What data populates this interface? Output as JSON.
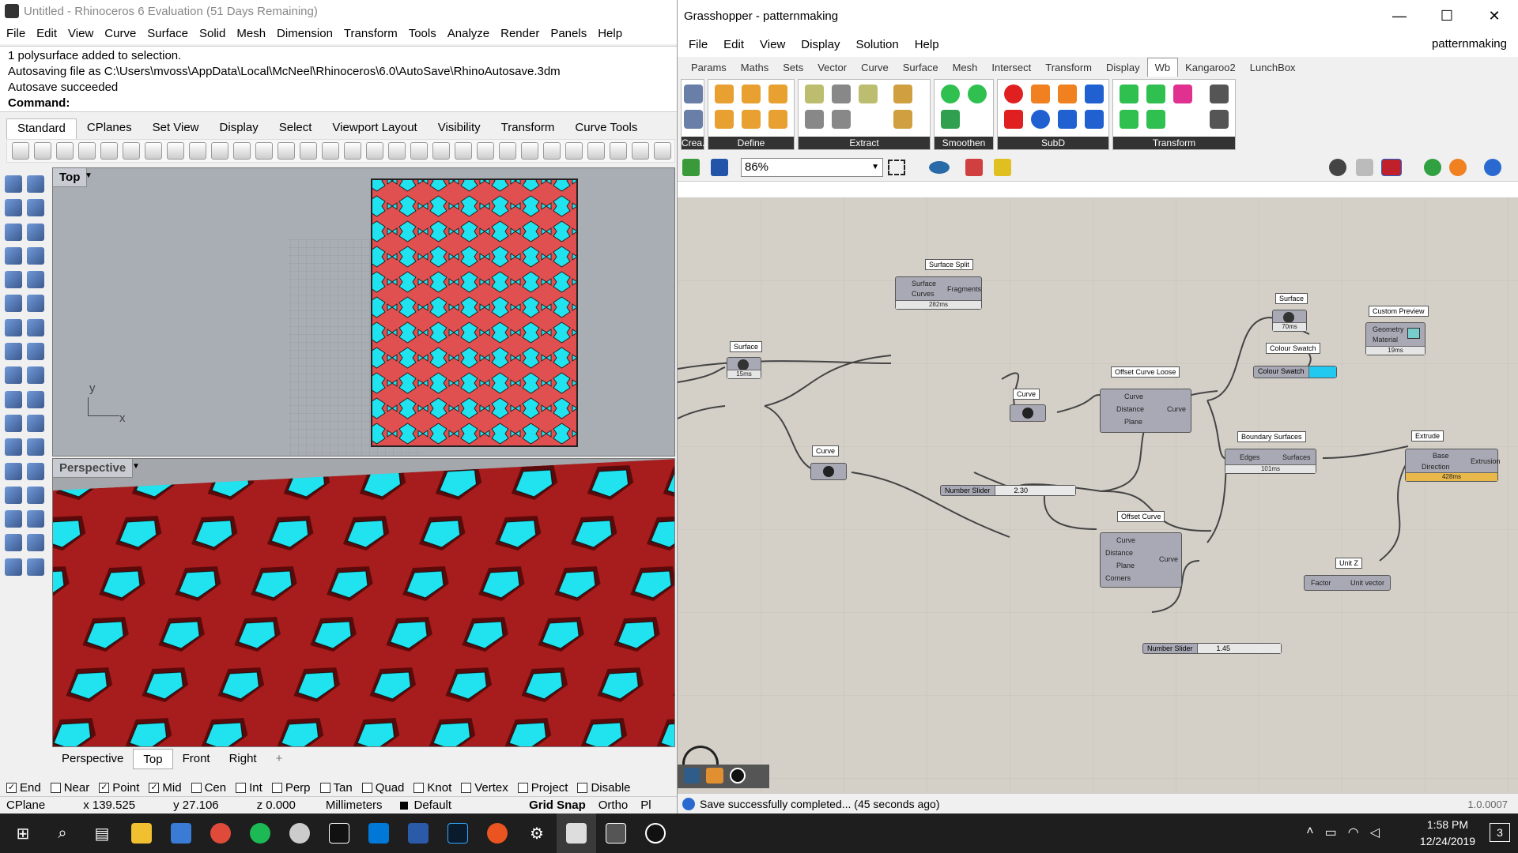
{
  "rhino": {
    "title": "Untitled - Rhinoceros 6 Evaluation (51 Days Remaining)",
    "menu": [
      "File",
      "Edit",
      "View",
      "Curve",
      "Surface",
      "Solid",
      "Mesh",
      "Dimension",
      "Transform",
      "Tools",
      "Analyze",
      "Render",
      "Panels",
      "Help"
    ],
    "command_history": [
      "1 polysurface added to selection.",
      "Autosaving file as C:\\Users\\mvoss\\AppData\\Local\\McNeel\\Rhinoceros\\6.0\\AutoSave\\RhinoAutosave.3dm",
      "Autosave succeeded"
    ],
    "command_label": "Command:",
    "toolbar_tabs": [
      "Standard",
      "CPlanes",
      "Set View",
      "Display",
      "Select",
      "Viewport Layout",
      "Visibility",
      "Transform",
      "Curve Tools"
    ],
    "viewport_top_label": "Top",
    "viewport_persp_label": "Perspective",
    "axis_y": "y",
    "axis_x": "x",
    "viewport_tabs": [
      "Perspective",
      "Top",
      "Front",
      "Right"
    ],
    "viewport_add": "+",
    "osnaps": [
      {
        "label": "End",
        "checked": true
      },
      {
        "label": "Near",
        "checked": false
      },
      {
        "label": "Point",
        "checked": true
      },
      {
        "label": "Mid",
        "checked": true
      },
      {
        "label": "Cen",
        "checked": false
      },
      {
        "label": "Int",
        "checked": false
      },
      {
        "label": "Perp",
        "checked": false
      },
      {
        "label": "Tan",
        "checked": false
      },
      {
        "label": "Quad",
        "checked": false
      },
      {
        "label": "Knot",
        "checked": false
      },
      {
        "label": "Vertex",
        "checked": false
      },
      {
        "label": "Project",
        "checked": false
      },
      {
        "label": "Disable",
        "checked": false
      }
    ],
    "status": {
      "cplane": "CPlane",
      "x": "x 139.525",
      "y": "y 27.106",
      "z": "z 0.000",
      "units": "Millimeters",
      "layer": "Default",
      "grid_snap": "Grid Snap",
      "ortho": "Ortho",
      "planar": "Pl"
    },
    "colors": {
      "pattern_red": "#e05050",
      "pattern_cyan": "#21e3f0",
      "persp_red": "#a71c1c"
    }
  },
  "grasshopper": {
    "title": "Grasshopper - patternmaking",
    "window_buttons": [
      "—",
      "☐",
      "✕"
    ],
    "menu": [
      "File",
      "Edit",
      "View",
      "Display",
      "Solution",
      "Help"
    ],
    "doc_name": "patternmaking",
    "tabs": [
      "Params",
      "Maths",
      "Sets",
      "Vector",
      "Curve",
      "Surface",
      "Mesh",
      "Intersect",
      "Transform",
      "Display",
      "Wb",
      "Kangaroo2",
      "LunchBox"
    ],
    "active_tab": "Wb",
    "ribbon_groups": [
      "Crea...",
      "Define",
      "Extract",
      "Smoothen",
      "SubD",
      "Transform"
    ],
    "zoom": "86%",
    "status_message": "Save successfully completed... (45 seconds ago)",
    "version": "1.0.0007",
    "nodes": {
      "surface_split": {
        "label": "Surface Split",
        "inputs": [
          "Surface",
          "Curves"
        ],
        "output": "Fragments",
        "timing": "282ms"
      },
      "surface_param_1": {
        "label": "Surface",
        "timing": "15ms"
      },
      "curve_param_1": {
        "label": "Curve"
      },
      "curve_param_2": {
        "label": "Curve"
      },
      "surface_param_2": {
        "label": "Surface",
        "timing": "70ms"
      },
      "colour_swatch": {
        "label": "Colour Swatch",
        "name": "Colour Swatch",
        "color": "#21c8f0"
      },
      "custom_preview": {
        "label": "Custom Preview",
        "inputs": [
          "Geometry",
          "Material"
        ],
        "timing": "19ms"
      },
      "offset_curve_loose": {
        "label": "Offset Curve Loose",
        "inputs": [
          "Curve",
          "Distance",
          "Plane"
        ],
        "output": "Curve"
      },
      "boundary_surfaces": {
        "label": "Boundary Surfaces",
        "input": "Edges",
        "output": "Surfaces",
        "timing": "101ms"
      },
      "extrude": {
        "label": "Extrude",
        "inputs": [
          "Base",
          "Direction"
        ],
        "output": "Extrusion",
        "timing": "428ms"
      },
      "offset_curve": {
        "label": "Offset Curve",
        "inputs": [
          "Curve",
          "Distance",
          "Plane",
          "Corners"
        ],
        "output": "Curve"
      },
      "unit_z": {
        "label": "Unit Z",
        "input": "Factor",
        "output": "Unit vector"
      },
      "slider_1": {
        "name": "Number Slider",
        "value": "2.30"
      },
      "slider_2": {
        "name": "Number Slider",
        "value": "1.45"
      }
    }
  },
  "taskbar": {
    "time": "1:58 PM",
    "date": "12/24/2019",
    "notifications": "3"
  }
}
